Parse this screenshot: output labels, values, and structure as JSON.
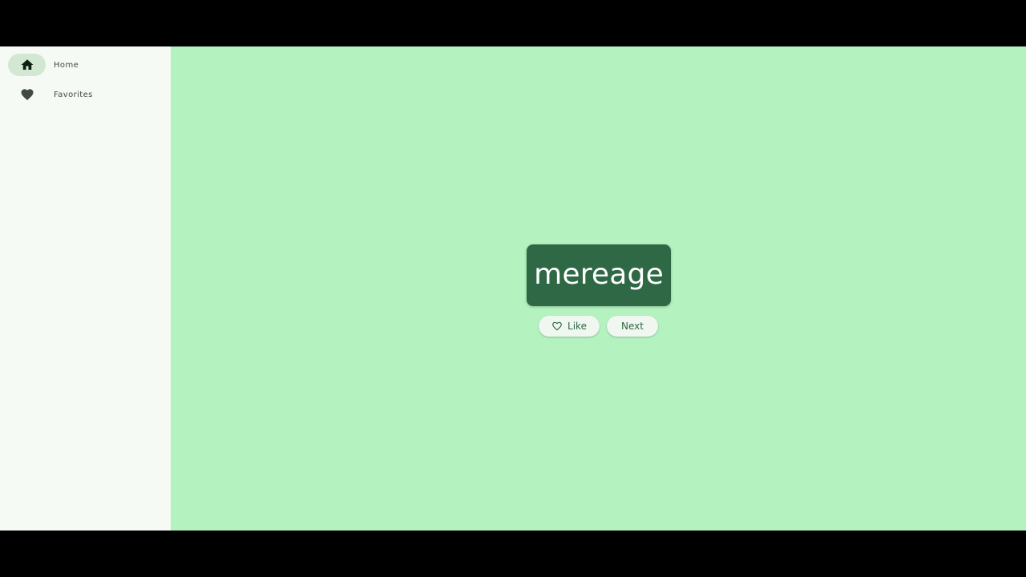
{
  "nav": {
    "items": [
      {
        "label": "Home",
        "icon": "home-icon",
        "active": true
      },
      {
        "label": "Favorites",
        "icon": "favorite-icon",
        "active": false
      }
    ]
  },
  "main": {
    "word": "mereage",
    "like_label": "Like",
    "like_icon": "favorite-border-icon",
    "next_label": "Next"
  },
  "colors": {
    "rail_bg": "#f5faf4",
    "main_bg": "#b4f2c0",
    "card_bg": "#2e6844",
    "active_indicator": "#d2e8d3",
    "button_bg": "#f0f7f0"
  }
}
